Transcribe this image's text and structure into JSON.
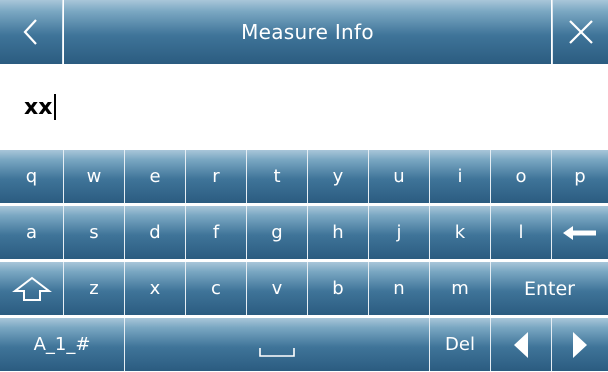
{
  "header": {
    "title": "Measure Info",
    "back_icon": "chevron-left-icon",
    "close_icon": "close-icon"
  },
  "input": {
    "value": "xx"
  },
  "keyboard": {
    "row1": [
      "q",
      "w",
      "e",
      "r",
      "t",
      "y",
      "u",
      "i",
      "o",
      "p"
    ],
    "row2": [
      "a",
      "s",
      "d",
      "f",
      "g",
      "h",
      "j",
      "k",
      "l"
    ],
    "row2_backspace_icon": "arrow-left-icon",
    "row3_shift_icon": "shift-arrow-up-icon",
    "row3": [
      "z",
      "x",
      "c",
      "v",
      "b",
      "n",
      "m"
    ],
    "enter_label": "Enter",
    "symbols_label": "A_1_#",
    "space_icon": "space-bar-icon",
    "del_label": "Del",
    "cursor_left_icon": "triangle-left-icon",
    "cursor_right_icon": "triangle-right-icon"
  },
  "colors": {
    "key_top": "#a9c6d9",
    "key_bottom": "#2b5c80",
    "text": "#ffffff"
  }
}
